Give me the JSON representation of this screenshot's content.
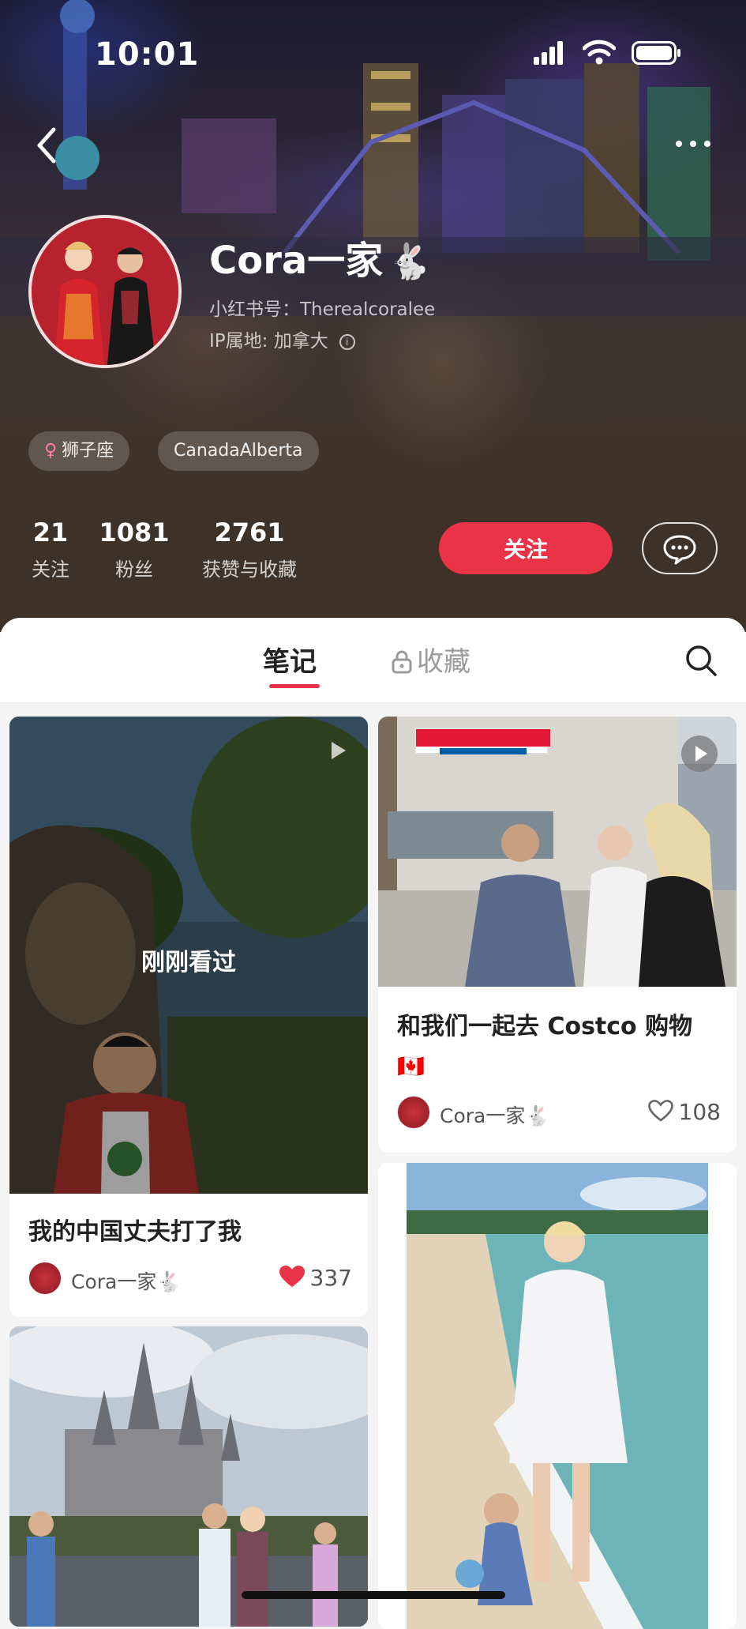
{
  "status_bar": {
    "time": "10:01"
  },
  "profile": {
    "name": "Cora一家",
    "rabbit_emoji": "🐇",
    "red_id": "小红书号：Therealcoralee",
    "ip_location": "IP属地: 加拿大",
    "tags": [
      "狮子座",
      "CanadaAlberta"
    ],
    "stats": [
      {
        "value": "21",
        "label": "关注"
      },
      {
        "value": "1081",
        "label": "粉丝"
      },
      {
        "value": "2761",
        "label": "获赞与收藏"
      }
    ],
    "follow_label": "关注"
  },
  "tabs": {
    "notes": "笔记",
    "collections": "收藏"
  },
  "notes": [
    {
      "title": "我的中国丈夫打了我",
      "overlay": "刚刚看过",
      "author": "Cora一家",
      "author_emoji": "🐇",
      "likes": "337",
      "liked": true
    },
    {
      "title": "和我们一起去 Costco 购物",
      "title_emoji": "🇨🇦",
      "author": "Cora一家",
      "author_emoji": "🐇",
      "likes": "108",
      "liked": false
    }
  ],
  "colors": {
    "accent": "#ea3346",
    "header_bg": "#3d3128"
  }
}
